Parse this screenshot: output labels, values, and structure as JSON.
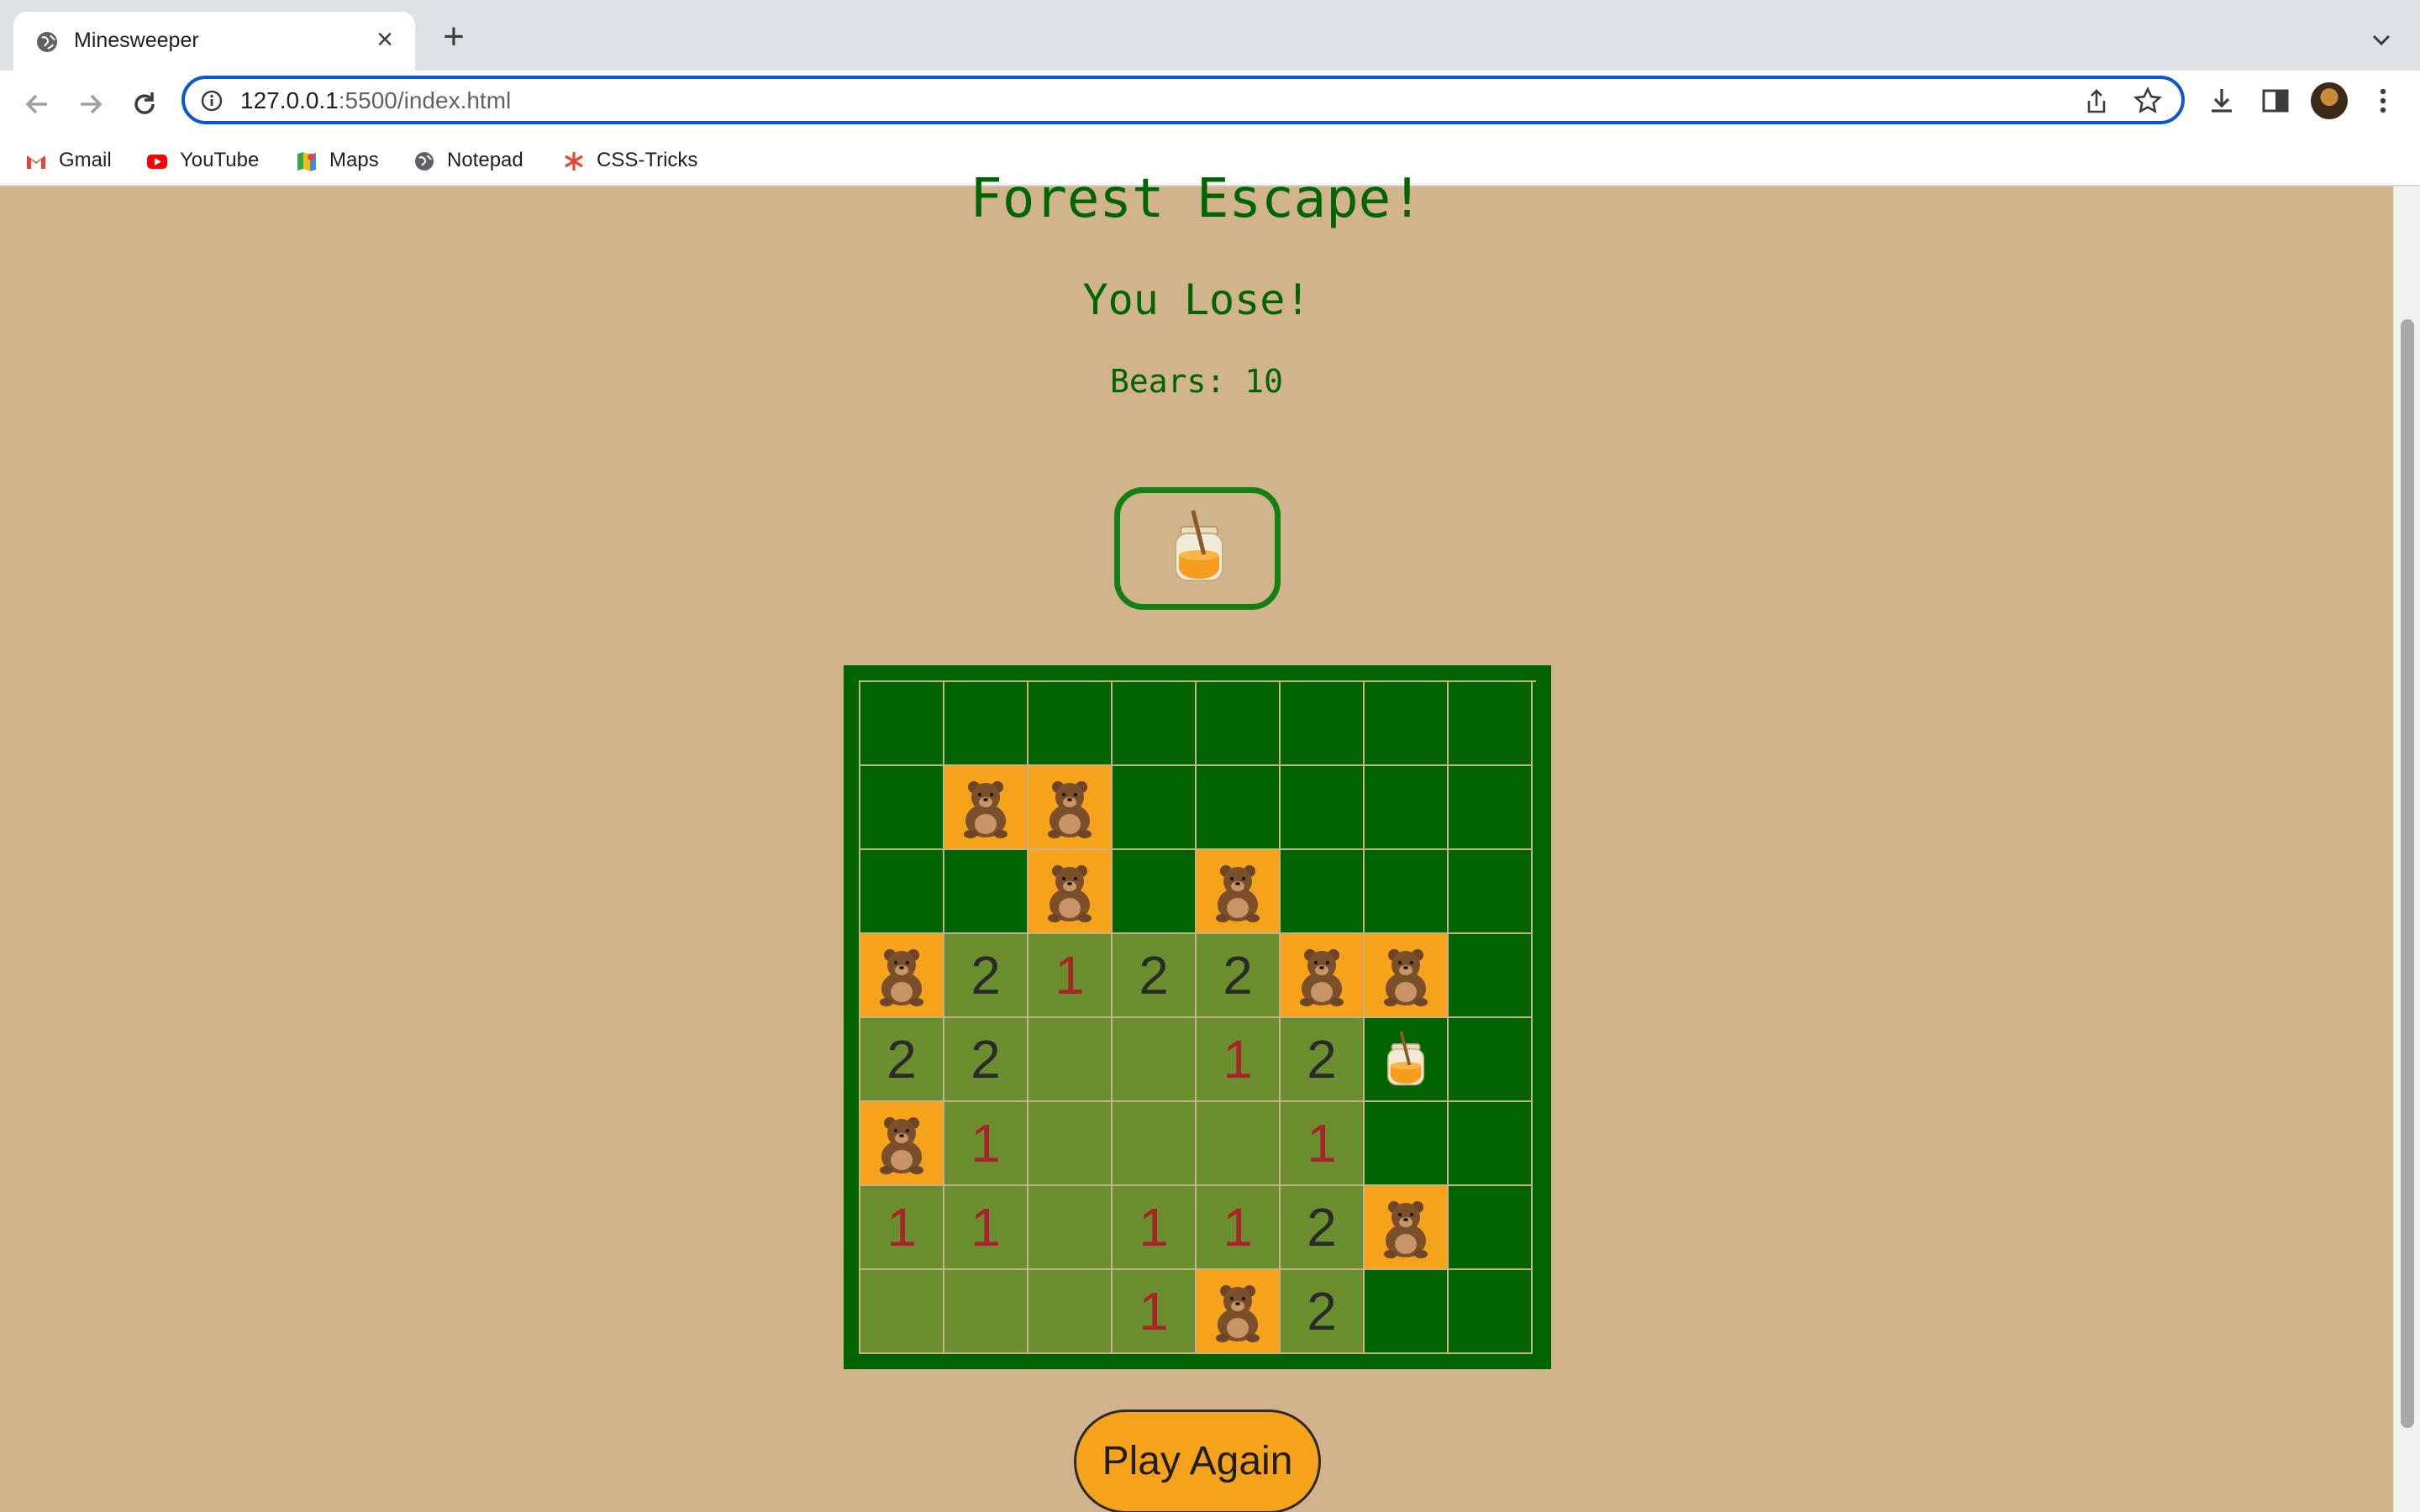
{
  "browser": {
    "tab_title": "Minesweeper",
    "url_host": "127.0.0.1",
    "url_rest": ":5500/index.html",
    "bookmarks": [
      {
        "label": "Gmail",
        "icon": "gmail-icon"
      },
      {
        "label": "YouTube",
        "icon": "youtube-icon"
      },
      {
        "label": "Maps",
        "icon": "maps-icon"
      },
      {
        "label": "Notepad",
        "icon": "globe-icon"
      },
      {
        "label": "CSS-Tricks",
        "icon": "css-tricks-icon"
      }
    ]
  },
  "game": {
    "title": "Forest Escape!",
    "status": "You Lose!",
    "counter_label": "Bears: ",
    "counter_value": "10",
    "face_icon": "honey-jar-icon",
    "play_again_label": "Play Again",
    "board": [
      [
        "H",
        "H",
        "H",
        "H",
        "H",
        "H",
        "H",
        "H"
      ],
      [
        "H",
        "B",
        "B",
        "H",
        "H",
        "H",
        "H",
        "H"
      ],
      [
        "H",
        "H",
        "B",
        "H",
        "B",
        "H",
        "H",
        "H"
      ],
      [
        "B",
        "2",
        "1",
        "2",
        "2",
        "B",
        "B",
        "H"
      ],
      [
        "2",
        "2",
        "O",
        "O",
        "1",
        "2",
        "F",
        "H"
      ],
      [
        "B",
        "1",
        "O",
        "O",
        "O",
        "1",
        "H",
        "H"
      ],
      [
        "1",
        "1",
        "O",
        "1",
        "1",
        "2",
        "B",
        "H"
      ],
      [
        "O",
        "O",
        "O",
        "1",
        "B",
        "2",
        "H",
        "H"
      ]
    ],
    "legend": {
      "H": "hidden",
      "B": "bear",
      "F": "honey-flag",
      "O": "open-empty"
    }
  },
  "colors": {
    "background": "#d2b48c",
    "board": "#006400",
    "open_cell": "#6b8e2f",
    "bear_cell": "#f7a21b",
    "one": "#a8232b",
    "two": "#2a2a2a"
  }
}
